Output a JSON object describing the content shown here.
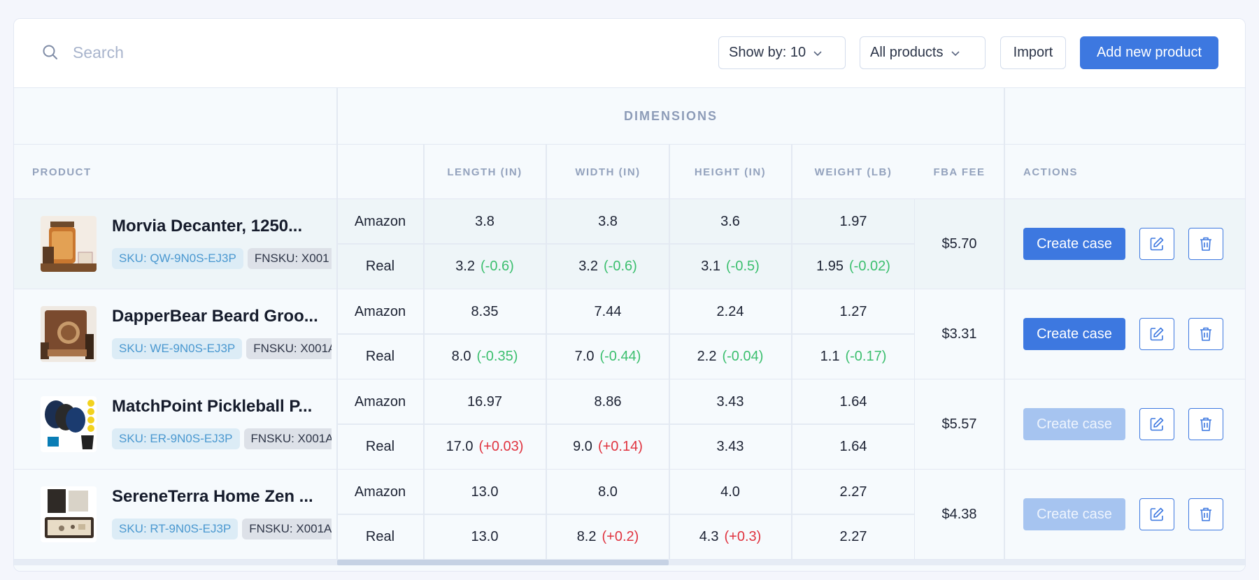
{
  "search": {
    "placeholder": "Search"
  },
  "toolbar": {
    "show_by_label": "Show by: 10",
    "filter_label": "All products",
    "import_label": "Import",
    "add_label": "Add new product"
  },
  "table": {
    "group_header": "DIMENSIONS",
    "columns": {
      "product": "PRODUCT",
      "length": "LENGTH (IN)",
      "width": "WIDTH (IN)",
      "height": "HEIGHT (IN)",
      "weight": "WEIGHT (LB)",
      "fee": "FBA FEE",
      "actions": "ACTIONS"
    },
    "source_labels": {
      "amazon": "Amazon",
      "real": "Real"
    },
    "create_label": "Create case",
    "rows": [
      {
        "name": "Morvia Decanter, 1250...",
        "sku": "SKU: QW-9N0S-EJ3P",
        "fnsku": "FNSKU: X001",
        "amazon": [
          "3.8",
          "3.8",
          "3.6",
          "1.97"
        ],
        "real": [
          "3.2",
          "3.2",
          "3.1",
          "1.95"
        ],
        "diff": [
          "(-0.6)",
          "(-0.6)",
          "(-0.5)",
          "(-0.02)"
        ],
        "diff_sign": [
          "neg",
          "neg",
          "neg",
          "neg"
        ],
        "fee": "$5.70",
        "case_enabled": true
      },
      {
        "name": "DapperBear Beard Groo...",
        "sku": "SKU: WE-9N0S-EJ3P",
        "fnsku": "FNSKU: X001A",
        "amazon": [
          "8.35",
          "7.44",
          "2.24",
          "1.27"
        ],
        "real": [
          "8.0",
          "7.0",
          "2.2",
          "1.1"
        ],
        "diff": [
          "(-0.35)",
          "(-0.44)",
          "(-0.04)",
          "(-0.17)"
        ],
        "diff_sign": [
          "neg",
          "neg",
          "neg",
          "neg"
        ],
        "fee": "$3.31",
        "case_enabled": true
      },
      {
        "name": "MatchPoint Pickleball P...",
        "sku": "SKU: ER-9N0S-EJ3P",
        "fnsku": "FNSKU: X001A",
        "amazon": [
          "16.97",
          "8.86",
          "3.43",
          "1.64"
        ],
        "real": [
          "17.0",
          "9.0",
          "3.43",
          "1.64"
        ],
        "diff": [
          "(+0.03)",
          "(+0.14)",
          "",
          ""
        ],
        "diff_sign": [
          "pos",
          "pos",
          "",
          ""
        ],
        "fee": "$5.57",
        "case_enabled": false
      },
      {
        "name": "SereneTerra Home Zen ...",
        "sku": "SKU: RT-9N0S-EJ3P",
        "fnsku": "FNSKU: X001A",
        "amazon": [
          "13.0",
          "8.0",
          "4.0",
          "2.27"
        ],
        "real": [
          "13.0",
          "8.2",
          "4.3",
          "2.27"
        ],
        "diff": [
          "",
          "(+0.2)",
          "(+0.3)",
          ""
        ],
        "diff_sign": [
          "",
          "pos",
          "pos",
          ""
        ],
        "fee": "$4.38",
        "case_enabled": false
      }
    ]
  },
  "icons": [
    "search-icon",
    "chevron-down-icon",
    "edit-icon",
    "trash-icon"
  ],
  "colors": {
    "accent": "#3d78e0",
    "negative_diff": "#3bbf6e",
    "positive_diff": "#e0333f",
    "sku_text": "#4a98d0"
  }
}
